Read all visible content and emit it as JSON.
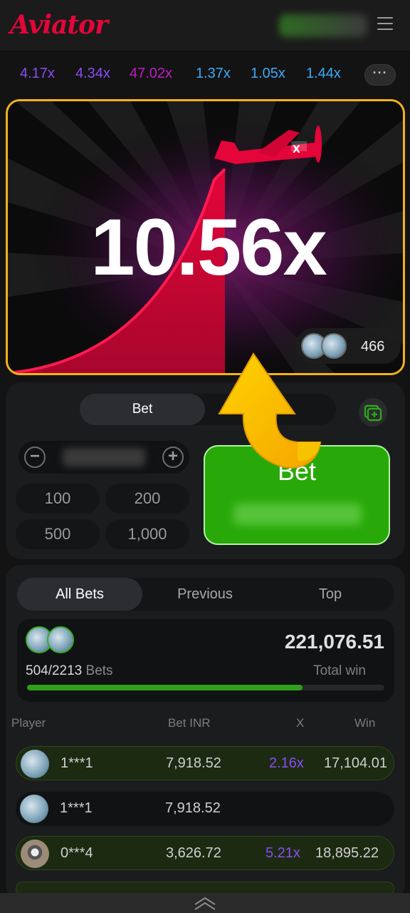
{
  "header": {
    "logo": "Aviator",
    "menu_icon": "hamburger-menu-icon"
  },
  "history": {
    "multipliers": [
      {
        "value": "4.17x",
        "color": "#8a4cf5"
      },
      {
        "value": "4.34x",
        "color": "#8a4cf5"
      },
      {
        "value": "47.02x",
        "color": "#c01cc3"
      },
      {
        "value": "1.37x",
        "color": "#3fa9f5"
      },
      {
        "value": "1.05x",
        "color": "#3fa9f5"
      },
      {
        "value": "1.44x",
        "color": "#3fa9f5"
      }
    ],
    "more_label": "···"
  },
  "game": {
    "multiplier": "10.56x",
    "players_count": "466",
    "accent_color": "#e40539"
  },
  "bet_panel": {
    "tab_bet": "Bet",
    "minus_label": "−",
    "plus_label": "+",
    "quick_amounts": [
      "100",
      "200",
      "500",
      "1,000"
    ],
    "bet_button_label": "Bet",
    "button_color": "#28a909"
  },
  "bets": {
    "tabs": [
      "All Bets",
      "Previous",
      "Top"
    ],
    "bets_count": "504/2213",
    "bets_label": "Bets",
    "total_win": "221,076.51",
    "total_win_label": "Total win",
    "progress": 0.77,
    "columns": [
      "Player",
      "Bet INR",
      "X",
      "Win"
    ],
    "rows": [
      {
        "player": "1***1",
        "bet": "7,918.52",
        "x": "2.16x",
        "win": "17,104.01",
        "state": "win"
      },
      {
        "player": "1***1",
        "bet": "7,918.52",
        "x": "",
        "win": "",
        "state": "lose"
      },
      {
        "player": "0***4",
        "bet": "3,626.72",
        "x": "5.21x",
        "win": "18,895.22",
        "state": "win"
      }
    ]
  }
}
